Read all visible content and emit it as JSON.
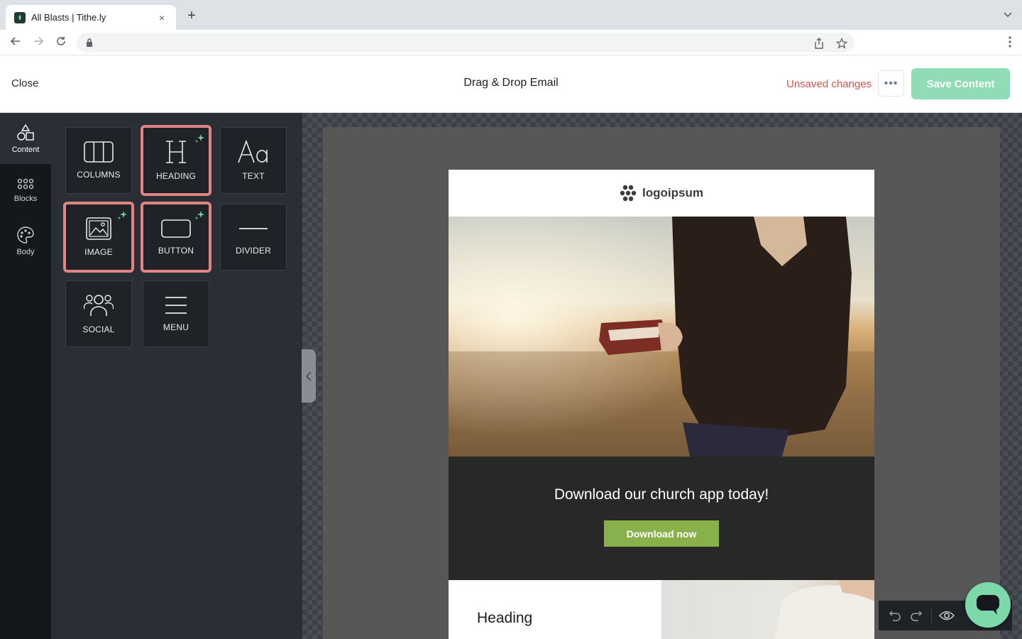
{
  "browser": {
    "tab_title": "All Blasts | Tithe.ly",
    "tab_close": "×",
    "new_tab": "+"
  },
  "header": {
    "close_label": "Close",
    "title": "Drag & Drop Email",
    "status": "Unsaved changes",
    "more_label": "•••",
    "save_label": "Save Content"
  },
  "rail": {
    "items": [
      {
        "label": "Content",
        "icon": "shapes-icon",
        "active": true
      },
      {
        "label": "Blocks",
        "icon": "grid-icon",
        "active": false
      },
      {
        "label": "Body",
        "icon": "palette-icon",
        "active": false
      }
    ]
  },
  "tiles": [
    {
      "label": "COLUMNS",
      "icon": "columns-icon"
    },
    {
      "label": "HEADING",
      "icon": "heading-icon",
      "highlighted": true,
      "sparkle": true
    },
    {
      "label": "TEXT",
      "icon": "text-icon"
    },
    {
      "label": "IMAGE",
      "icon": "image-icon",
      "highlighted": true,
      "sparkle": true
    },
    {
      "label": "BUTTON",
      "icon": "button-icon",
      "highlighted": true,
      "sparkle": true
    },
    {
      "label": "DIVIDER",
      "icon": "divider-icon"
    },
    {
      "label": "SOCIAL",
      "icon": "social-icon"
    },
    {
      "label": "MENU",
      "icon": "menu-icon"
    }
  ],
  "email": {
    "logo_text": "logoipsum",
    "cta_title": "Download our church app today!",
    "cta_button": "Download now",
    "bottom_heading": "Heading"
  },
  "colors": {
    "accent": "#8fdcb5",
    "warning": "#d9534f",
    "highlight": "#e08585",
    "cta_green": "#88b04b"
  }
}
